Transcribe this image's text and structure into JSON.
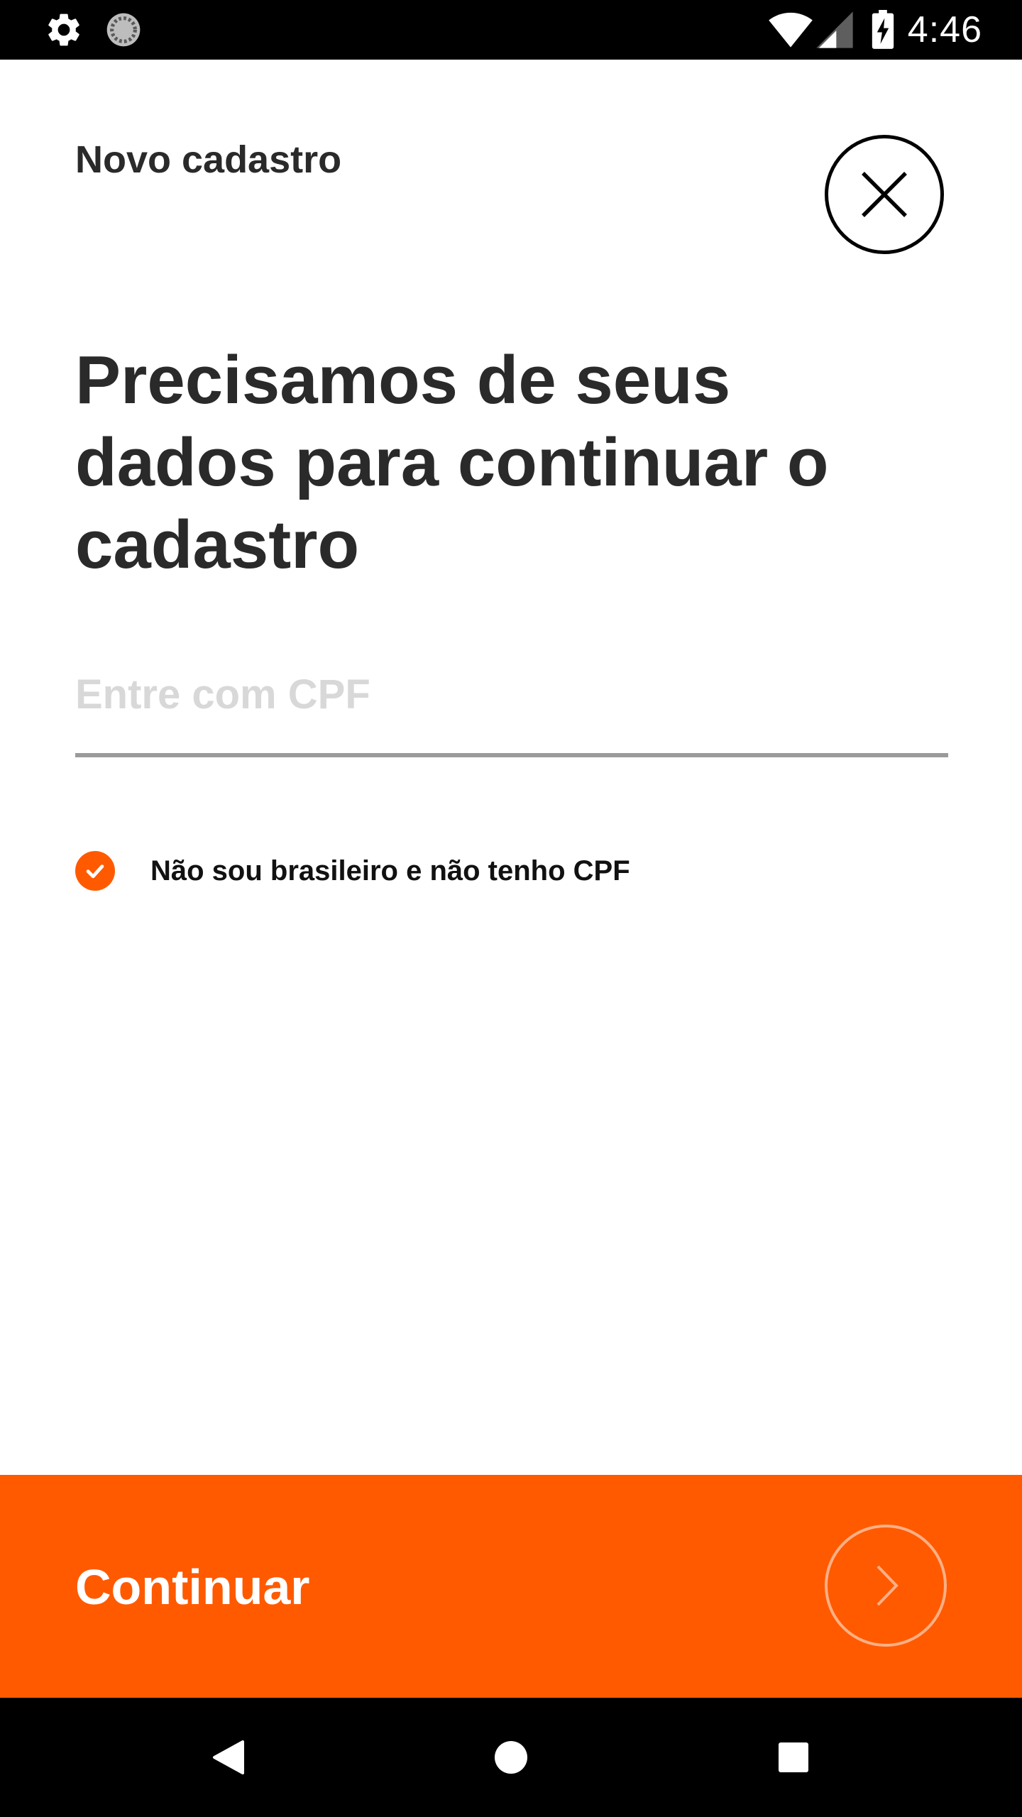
{
  "status_bar": {
    "time": "4:46",
    "icons": [
      "gear-icon",
      "sync-icon",
      "wifi-icon",
      "signal-icon",
      "battery-charging-icon"
    ]
  },
  "header": {
    "title": "Novo cadastro",
    "close_icon": "close-icon"
  },
  "main": {
    "heading": "Precisamos de seus dados para continuar o cadastro",
    "cpf_input": {
      "placeholder": "Entre com CPF",
      "value": ""
    },
    "no_cpf_checkbox": {
      "label": "Não sou brasileiro e não tenho CPF",
      "checked": true
    }
  },
  "footer": {
    "continue_label": "Continuar",
    "arrow_icon": "chevron-right-icon"
  },
  "nav_bar": {
    "buttons": [
      "back-icon",
      "home-icon",
      "recents-icon"
    ]
  },
  "colors": {
    "accent": "#ff5a00",
    "text_dark": "#2a2a2a",
    "placeholder": "#d8d8d8",
    "underline": "#9a9a9a",
    "status_bar": "#000000"
  }
}
